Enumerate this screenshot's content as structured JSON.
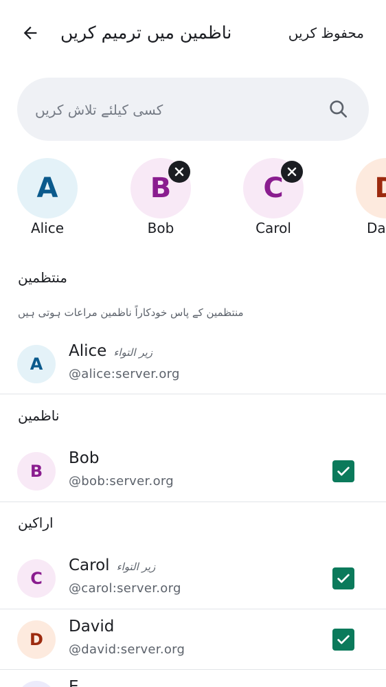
{
  "header": {
    "title": "ناظمین میں ترمیم کریں",
    "save_label": "محفوظ کریں",
    "back_icon": "arrow-left-icon"
  },
  "search": {
    "placeholder": "کسی کیلئے تلاش کریں",
    "value": "",
    "icon": "search-icon"
  },
  "selected": [
    {
      "initial": "A",
      "name": "Alice",
      "color": "blue",
      "removable": false
    },
    {
      "initial": "B",
      "name": "Bob",
      "color": "pink",
      "removable": true
    },
    {
      "initial": "C",
      "name": "Carol",
      "color": "pink",
      "removable": true
    },
    {
      "initial": "D",
      "name": "David",
      "color": "peach",
      "removable": false
    }
  ],
  "sections": {
    "admins": {
      "title": "منتظمین",
      "description": "منتظمین کے پاس خودکاراً ناظمین مراعات ہوتی ہیں"
    },
    "moderators": {
      "title": "ناظمین"
    },
    "members": {
      "title": "اراکین"
    }
  },
  "rows": {
    "alice": {
      "initial": "A",
      "name": "Alice",
      "tag": "زیر التواء",
      "user_id": "@alice:server.org",
      "color": "blue",
      "checked": false
    },
    "bob": {
      "initial": "B",
      "name": "Bob",
      "tag": "",
      "user_id": "@bob:server.org",
      "color": "pink",
      "checked": true
    },
    "carol": {
      "initial": "C",
      "name": "Carol",
      "tag": "زیر التواء",
      "user_id": "@carol:server.org",
      "color": "pink",
      "checked": true
    },
    "david": {
      "initial": "D",
      "name": "David",
      "tag": "",
      "user_id": "@david:server.org",
      "color": "peach",
      "checked": true
    },
    "eve": {
      "initial": "E",
      "name": "E",
      "color": "lavender"
    }
  },
  "colors": {
    "checkbox_accent": "#0b7a5b",
    "search_bg": "#eff1f5",
    "text_primary": "#1b1d22",
    "text_secondary": "#5c626b"
  }
}
